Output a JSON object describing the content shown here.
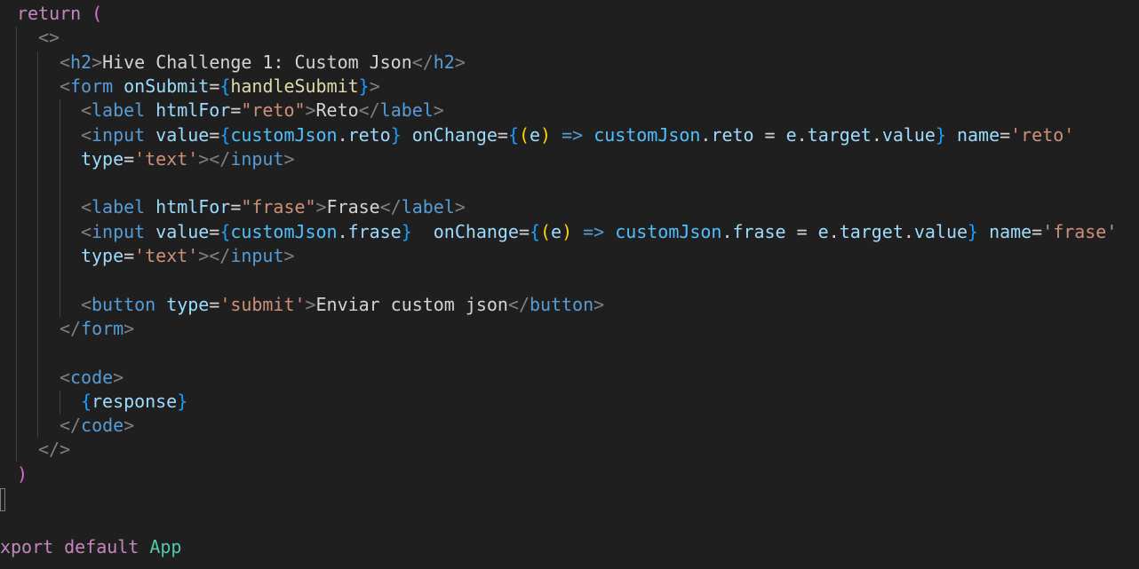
{
  "code_lines": [
    {
      "tokens": [
        {
          "t": "return",
          "c": "t-kw"
        },
        {
          "t": " ",
          "c": "t-txt"
        },
        {
          "t": "(",
          "c": "t-mag"
        }
      ]
    },
    {
      "tokens": [
        {
          "t": "<>",
          "c": "t-punct"
        }
      ]
    },
    {
      "tokens": [
        {
          "t": "<",
          "c": "t-punct"
        },
        {
          "t": "h2",
          "c": "t-tag"
        },
        {
          "t": ">",
          "c": "t-punct"
        },
        {
          "t": "Hive Challenge 1: Custom Json",
          "c": "t-txt"
        },
        {
          "t": "</",
          "c": "t-punct"
        },
        {
          "t": "h2",
          "c": "t-tag"
        },
        {
          "t": ">",
          "c": "t-punct"
        }
      ]
    },
    {
      "tokens": [
        {
          "t": "<",
          "c": "t-punct"
        },
        {
          "t": "form",
          "c": "t-tag"
        },
        {
          "t": " ",
          "c": "t-txt"
        },
        {
          "t": "onSubmit",
          "c": "t-attr"
        },
        {
          "t": "=",
          "c": "t-op"
        },
        {
          "t": "{",
          "c": "t-brace"
        },
        {
          "t": "handleSubmit",
          "c": "t-func"
        },
        {
          "t": "}",
          "c": "t-brace"
        },
        {
          "t": ">",
          "c": "t-punct"
        }
      ]
    },
    {
      "tokens": [
        {
          "t": "<",
          "c": "t-punct"
        },
        {
          "t": "label",
          "c": "t-tag"
        },
        {
          "t": " ",
          "c": "t-txt"
        },
        {
          "t": "htmlFor",
          "c": "t-attr"
        },
        {
          "t": "=",
          "c": "t-op"
        },
        {
          "t": "\"reto\"",
          "c": "t-str"
        },
        {
          "t": ">",
          "c": "t-punct"
        },
        {
          "t": "Reto",
          "c": "t-txt"
        },
        {
          "t": "</",
          "c": "t-punct"
        },
        {
          "t": "label",
          "c": "t-tag"
        },
        {
          "t": ">",
          "c": "t-punct"
        }
      ]
    },
    {
      "tokens": [
        {
          "t": "<",
          "c": "t-punct"
        },
        {
          "t": "input",
          "c": "t-tag"
        },
        {
          "t": " ",
          "c": "t-txt"
        },
        {
          "t": "value",
          "c": "t-attr"
        },
        {
          "t": "=",
          "c": "t-op"
        },
        {
          "t": "{",
          "c": "t-brace"
        },
        {
          "t": "customJson",
          "c": "t-var"
        },
        {
          "t": ".",
          "c": "t-op"
        },
        {
          "t": "reto",
          "c": "t-attr"
        },
        {
          "t": "}",
          "c": "t-brace"
        },
        {
          "t": " ",
          "c": "t-txt"
        },
        {
          "t": "onChange",
          "c": "t-attr"
        },
        {
          "t": "=",
          "c": "t-op"
        },
        {
          "t": "{",
          "c": "t-brace"
        },
        {
          "t": "(",
          "c": "t-paren"
        },
        {
          "t": "e",
          "c": "t-attr"
        },
        {
          "t": ")",
          "c": "t-paren"
        },
        {
          "t": " ",
          "c": "t-txt"
        },
        {
          "t": "=>",
          "c": "t-arrow"
        },
        {
          "t": " ",
          "c": "t-txt"
        },
        {
          "t": "customJson",
          "c": "t-var"
        },
        {
          "t": ".",
          "c": "t-op"
        },
        {
          "t": "reto",
          "c": "t-attr"
        },
        {
          "t": " = ",
          "c": "t-op"
        },
        {
          "t": "e",
          "c": "t-attr"
        },
        {
          "t": ".",
          "c": "t-op"
        },
        {
          "t": "target",
          "c": "t-attr"
        },
        {
          "t": ".",
          "c": "t-op"
        },
        {
          "t": "value",
          "c": "t-attr"
        },
        {
          "t": "}",
          "c": "t-brace"
        },
        {
          "t": " ",
          "c": "t-txt"
        },
        {
          "t": "name",
          "c": "t-attr"
        },
        {
          "t": "=",
          "c": "t-op"
        },
        {
          "t": "'reto'",
          "c": "t-str"
        }
      ]
    },
    {
      "tokens": [
        {
          "t": "type",
          "c": "t-attr"
        },
        {
          "t": "=",
          "c": "t-op"
        },
        {
          "t": "'text'",
          "c": "t-str"
        },
        {
          "t": "></",
          "c": "t-punct"
        },
        {
          "t": "input",
          "c": "t-tag"
        },
        {
          "t": ">",
          "c": "t-punct"
        }
      ]
    },
    {
      "tokens": []
    },
    {
      "tokens": [
        {
          "t": "<",
          "c": "t-punct"
        },
        {
          "t": "label",
          "c": "t-tag"
        },
        {
          "t": " ",
          "c": "t-txt"
        },
        {
          "t": "htmlFor",
          "c": "t-attr"
        },
        {
          "t": "=",
          "c": "t-op"
        },
        {
          "t": "\"frase\"",
          "c": "t-str"
        },
        {
          "t": ">",
          "c": "t-punct"
        },
        {
          "t": "Frase",
          "c": "t-txt"
        },
        {
          "t": "</",
          "c": "t-punct"
        },
        {
          "t": "label",
          "c": "t-tag"
        },
        {
          "t": ">",
          "c": "t-punct"
        }
      ]
    },
    {
      "tokens": [
        {
          "t": "<",
          "c": "t-punct"
        },
        {
          "t": "input",
          "c": "t-tag"
        },
        {
          "t": " ",
          "c": "t-txt"
        },
        {
          "t": "value",
          "c": "t-attr"
        },
        {
          "t": "=",
          "c": "t-op"
        },
        {
          "t": "{",
          "c": "t-brace"
        },
        {
          "t": "customJson",
          "c": "t-var"
        },
        {
          "t": ".",
          "c": "t-op"
        },
        {
          "t": "frase",
          "c": "t-attr"
        },
        {
          "t": "}",
          "c": "t-brace"
        },
        {
          "t": "  ",
          "c": "t-txt"
        },
        {
          "t": "onChange",
          "c": "t-attr"
        },
        {
          "t": "=",
          "c": "t-op"
        },
        {
          "t": "{",
          "c": "t-brace"
        },
        {
          "t": "(",
          "c": "t-paren"
        },
        {
          "t": "e",
          "c": "t-attr"
        },
        {
          "t": ")",
          "c": "t-paren"
        },
        {
          "t": " ",
          "c": "t-txt"
        },
        {
          "t": "=>",
          "c": "t-arrow"
        },
        {
          "t": " ",
          "c": "t-txt"
        },
        {
          "t": "customJson",
          "c": "t-var"
        },
        {
          "t": ".",
          "c": "t-op"
        },
        {
          "t": "frase",
          "c": "t-attr"
        },
        {
          "t": " = ",
          "c": "t-op"
        },
        {
          "t": "e",
          "c": "t-attr"
        },
        {
          "t": ".",
          "c": "t-op"
        },
        {
          "t": "target",
          "c": "t-attr"
        },
        {
          "t": ".",
          "c": "t-op"
        },
        {
          "t": "value",
          "c": "t-attr"
        },
        {
          "t": "}",
          "c": "t-brace"
        },
        {
          "t": " ",
          "c": "t-txt"
        },
        {
          "t": "name",
          "c": "t-attr"
        },
        {
          "t": "=",
          "c": "t-op"
        },
        {
          "t": "'frase'",
          "c": "t-str"
        }
      ]
    },
    {
      "tokens": [
        {
          "t": "type",
          "c": "t-attr"
        },
        {
          "t": "=",
          "c": "t-op"
        },
        {
          "t": "'text'",
          "c": "t-str"
        },
        {
          "t": "></",
          "c": "t-punct"
        },
        {
          "t": "input",
          "c": "t-tag"
        },
        {
          "t": ">",
          "c": "t-punct"
        }
      ]
    },
    {
      "tokens": []
    },
    {
      "tokens": [
        {
          "t": "<",
          "c": "t-punct"
        },
        {
          "t": "button",
          "c": "t-tag"
        },
        {
          "t": " ",
          "c": "t-txt"
        },
        {
          "t": "type",
          "c": "t-attr"
        },
        {
          "t": "=",
          "c": "t-op"
        },
        {
          "t": "'submit'",
          "c": "t-str"
        },
        {
          "t": ">",
          "c": "t-punct"
        },
        {
          "t": "Enviar custom json",
          "c": "t-txt"
        },
        {
          "t": "</",
          "c": "t-punct"
        },
        {
          "t": "button",
          "c": "t-tag"
        },
        {
          "t": ">",
          "c": "t-punct"
        }
      ]
    },
    {
      "tokens": [
        {
          "t": "</",
          "c": "t-punct"
        },
        {
          "t": "form",
          "c": "t-tag"
        },
        {
          "t": ">",
          "c": "t-punct"
        }
      ]
    },
    {
      "tokens": []
    },
    {
      "tokens": [
        {
          "t": "<",
          "c": "t-punct"
        },
        {
          "t": "code",
          "c": "t-tag"
        },
        {
          "t": ">",
          "c": "t-punct"
        }
      ]
    },
    {
      "tokens": [
        {
          "t": "{",
          "c": "t-brace"
        },
        {
          "t": "response",
          "c": "t-attr"
        },
        {
          "t": "}",
          "c": "t-brace"
        }
      ]
    },
    {
      "tokens": [
        {
          "t": "</",
          "c": "t-punct"
        },
        {
          "t": "code",
          "c": "t-tag"
        },
        {
          "t": ">",
          "c": "t-punct"
        }
      ]
    },
    {
      "tokens": [
        {
          "t": "</>",
          "c": "t-punct"
        }
      ]
    },
    {
      "tokens": [
        {
          "t": ")",
          "c": "t-mag"
        }
      ]
    },
    {
      "tokens": []
    },
    {
      "tokens": []
    },
    {
      "tokens": [
        {
          "t": "xport",
          "c": "t-kw"
        },
        {
          "t": " ",
          "c": "t-txt"
        },
        {
          "t": "default",
          "c": "t-kw"
        },
        {
          "t": " ",
          "c": "t-txt"
        },
        {
          "t": "App",
          "c": "t-cls"
        }
      ]
    }
  ],
  "colors": {
    "background": "#1f1f1f",
    "keyword": "#c586c0",
    "tag": "#569cd6",
    "attribute": "#9cdcfe",
    "string": "#ce9178",
    "bracket_brace": "#179fff",
    "bracket_paren": "#ffd700",
    "function": "#dcdcaa"
  }
}
